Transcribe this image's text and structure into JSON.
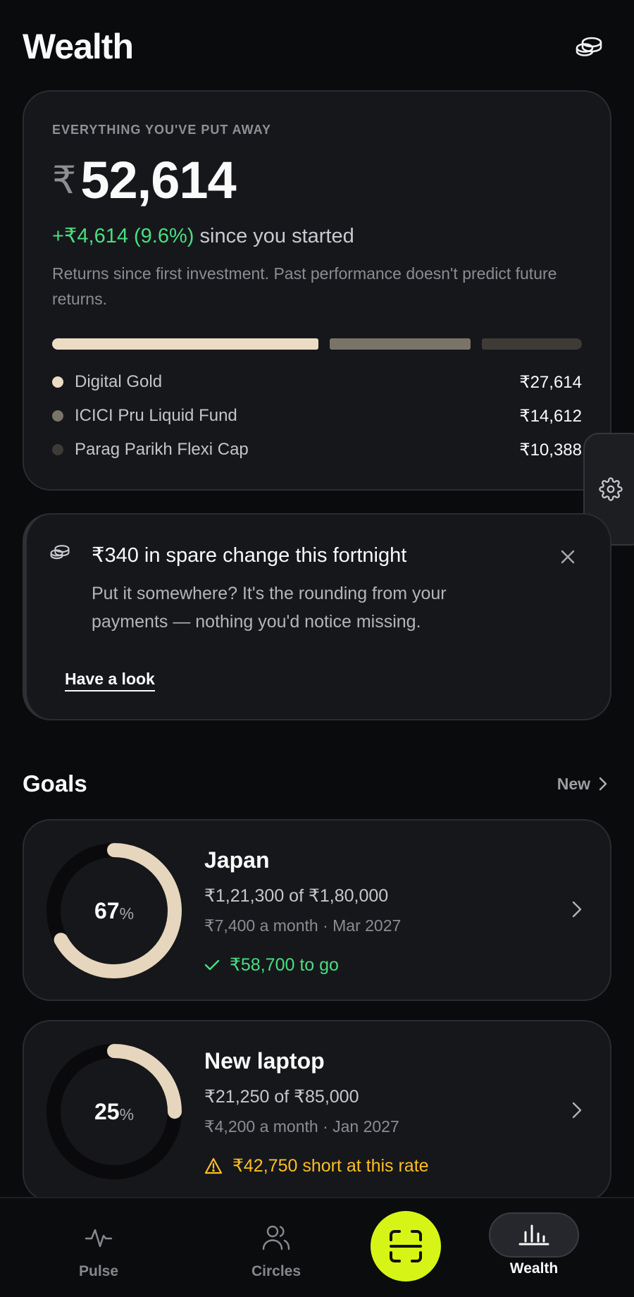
{
  "header": {
    "title": "Wealth",
    "icon": "coins-icon"
  },
  "summary": {
    "eyebrow": "EVERYTHING YOU'VE PUT AWAY",
    "currency": "₹",
    "total": "52,614",
    "gain": "+₹4,614 (9.6%)",
    "gain_suffix": " since you started",
    "disclaimer": "Returns since first investment. Past performance doesn't predict future returns.",
    "holdings": [
      {
        "name": "Digital Gold",
        "value": "₹27,614",
        "color": "#ecdcc3"
      },
      {
        "name": "ICICI Pru Liquid Fund",
        "value": "₹14,612",
        "color": "#7a7468"
      },
      {
        "name": "Parag Parikh Flexi Cap",
        "value": "₹10,388",
        "color": "#3e3b36"
      }
    ]
  },
  "side_tab": {
    "icon": "gear-icon"
  },
  "spare_change": {
    "icon": "coins-icon",
    "title": "₹340 in spare change this fortnight",
    "body": "Put it somewhere? It's the rounding from your payments — nothing you'd notice missing.",
    "link": "Have a look"
  },
  "goals": {
    "title": "Goals",
    "new_label": "New",
    "items": [
      {
        "name": "Japan",
        "percent": 67,
        "percent_label": "67",
        "progress": "₹1,21,300 of ₹1,80,000",
        "meta": "₹7,400 a month · Mar 2027",
        "status": "₹58,700 to go",
        "status_type": "ok"
      },
      {
        "name": "New laptop",
        "percent": 25,
        "percent_label": "25",
        "progress": "₹21,250 of ₹85,000",
        "meta": "₹4,200 a month · Jan 2027",
        "status": "₹42,750 short at this rate",
        "status_type": "warn"
      }
    ]
  },
  "nav": {
    "pulse": "Pulse",
    "circles": "Circles",
    "wealth": "Wealth",
    "accent": "#d6f516"
  }
}
